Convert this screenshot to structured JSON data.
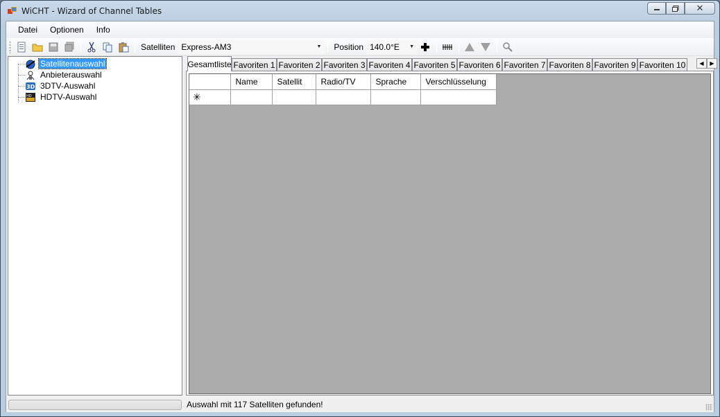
{
  "window": {
    "title": "WiCHT - Wizard of Channel Tables",
    "minimize": "▭",
    "maximize": "□",
    "close": "✕"
  },
  "menubar": {
    "items": [
      "Datei",
      "Optionen",
      "Info"
    ]
  },
  "toolbar": {
    "buttons": [
      "new-icon",
      "open-folder-icon",
      "save-icon",
      "save-all-icon",
      "cut-icon",
      "copy-icon",
      "paste-icon"
    ],
    "satellite_label": "Satelliten",
    "satellite_value": "Express-AM3",
    "position_label": "Position",
    "position_value": "140.0°E",
    "extra_buttons": [
      "add-icon",
      "ruler-icon",
      "move-up-icon",
      "move-down-icon",
      "search-icon"
    ]
  },
  "tree": {
    "items": [
      {
        "label": "Satellitenauswahl",
        "icon": "satellite-icon",
        "selected": true
      },
      {
        "label": "Anbieterauswahl",
        "icon": "provider-icon",
        "selected": false
      },
      {
        "label": "3DTV-Auswahl",
        "icon": "3dtv-icon",
        "selected": false
      },
      {
        "label": "HDTV-Auswahl",
        "icon": "hdtv-icon",
        "selected": false
      }
    ]
  },
  "tabs": [
    "Gesamtliste",
    "Favoriten 1",
    "Favoriten 2",
    "Favoriten 3",
    "Favoriten 4",
    "Favoriten 5",
    "Favoriten 6",
    "Favoriten 7",
    "Favoriten 8",
    "Favoriten 9",
    "Favoriten 10"
  ],
  "grid": {
    "columns": [
      "Name",
      "Satellit",
      "Radio/TV",
      "Sprache",
      "Verschlüsselung"
    ],
    "new_row_marker": "✳"
  },
  "status": {
    "text": "Auswahl mit 117 Satelliten gefunden!"
  },
  "colors": {
    "selection": "#3399ff",
    "grid_background": "#ababab"
  }
}
